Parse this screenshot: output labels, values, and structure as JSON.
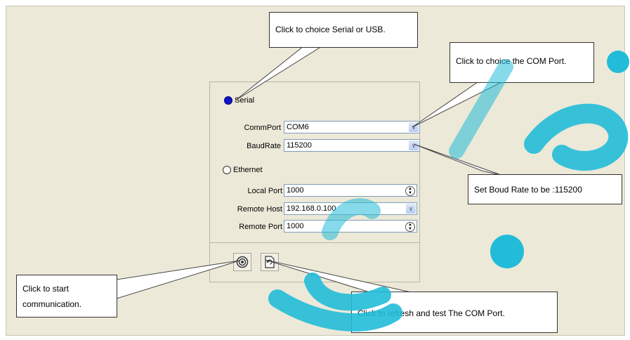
{
  "panel": {
    "serial": {
      "label": "Serial",
      "selected": true
    },
    "commport": {
      "label": "CommPort",
      "value": "COM6"
    },
    "baudrate": {
      "label": "BaudRate",
      "value": "115200"
    },
    "ethernet": {
      "label": "Ethernet",
      "selected": false
    },
    "local_port": {
      "label": "Local Port",
      "value": "1000"
    },
    "remote_host": {
      "label": "Remote Host",
      "value": "192.168.0.100"
    },
    "remote_port": {
      "label": "Remote Port",
      "value": "1000"
    }
  },
  "toolbar": {
    "start_icon": "target-icon",
    "refresh_icon": "refresh-icon"
  },
  "callouts": {
    "serial_usb": "Click to choice Serial or USB.",
    "com_port": "Click to choice the COM Port.",
    "baud": "Set Boud Rate to be :115200",
    "start_line1": "Click to start",
    "start_line2": "communication.",
    "refresh": "Click to refresh and test The COM Port."
  },
  "colors": {
    "panel_bg": "#ece9d8",
    "radio_selected": "#1212c8",
    "watermark": "#22bcd9"
  }
}
